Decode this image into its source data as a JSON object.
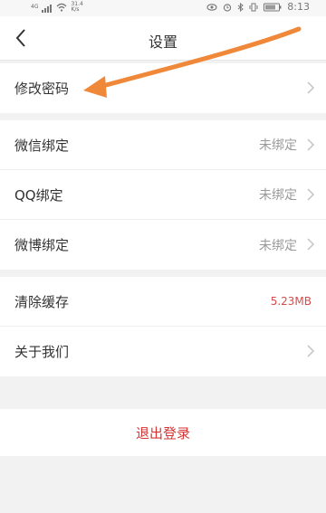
{
  "status_bar": {
    "network_type": "4G",
    "net_speed": "31.4",
    "net_speed_unit": "K/s",
    "time": "8:13"
  },
  "header": {
    "title": "设置"
  },
  "menu": {
    "change_password": {
      "label": "修改密码"
    },
    "wechat": {
      "label": "微信绑定",
      "value": "未绑定"
    },
    "qq": {
      "label": "QQ绑定",
      "value": "未绑定"
    },
    "weibo": {
      "label": "微博绑定",
      "value": "未绑定"
    },
    "clear_cache": {
      "label": "清除缓存",
      "value": "5.23MB"
    },
    "about": {
      "label": "关于我们"
    }
  },
  "logout": {
    "label": "退出登录"
  },
  "colors": {
    "accent_red": "#d63333",
    "annotation_arrow": "#f0883a"
  }
}
